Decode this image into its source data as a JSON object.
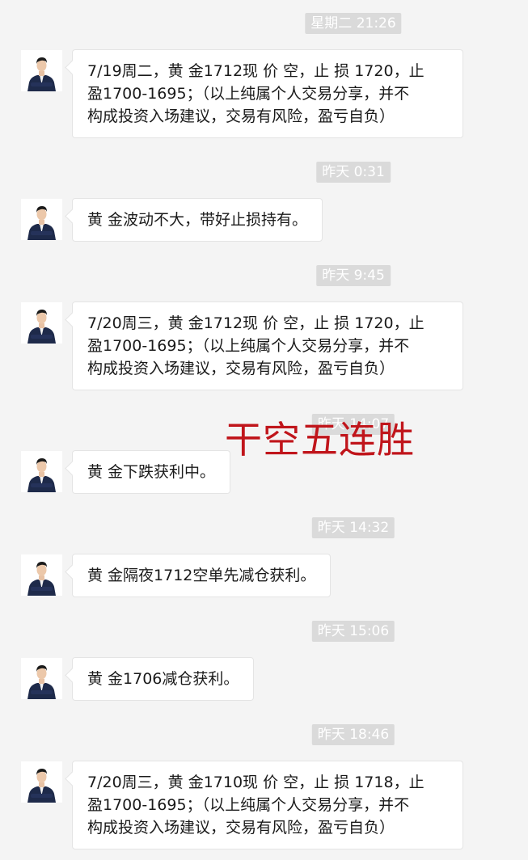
{
  "chat": {
    "messages": [
      {
        "time": "星期二 21:26",
        "lines": [
          "7/19周二，黄 金1712现 价 空，止 损 1720，止",
          "盈1700-1695；（以上纯属个人交易分享，并不",
          "构成投资入场建议，交易有风险，盈亏自负）"
        ]
      },
      {
        "time": "昨天 0:31",
        "lines": [
          "黄 金波动不大，带好止损持有。"
        ]
      },
      {
        "time": "昨天 9:45",
        "lines": [
          "7/20周三，黄 金1712现 价 空，止 损 1720，止",
          "盈1700-1695；（以上纯属个人交易分享，并不",
          "构成投资入场建议，交易有风险，盈亏自负）"
        ]
      },
      {
        "time": "昨天 14:07",
        "lines": [
          "黄 金下跌获利中。"
        ]
      },
      {
        "time": "昨天 14:32",
        "lines": [
          "黄 金隔夜1712空单先减仓获利。"
        ]
      },
      {
        "time": "昨天 15:06",
        "lines": [
          "黄 金1706减仓获利。"
        ]
      },
      {
        "time": "昨天 18:46",
        "lines": [
          "7/20周三，黄 金1710现 价 空，止 损 1718，止",
          "盈1700-1695；（以上纯属个人交易分享，并不",
          "构成投资入场建议，交易有风险，盈亏自负）"
        ]
      }
    ]
  },
  "overlay": {
    "stamp_text": "干空五连胜"
  },
  "colors": {
    "background": "#f4f4f4",
    "timestamp_bg": "#dadada",
    "bubble_bg": "#ffffff",
    "stamp_red": "#c0151b"
  },
  "icons": {
    "avatar": "man-in-suit-avatar-icon"
  }
}
